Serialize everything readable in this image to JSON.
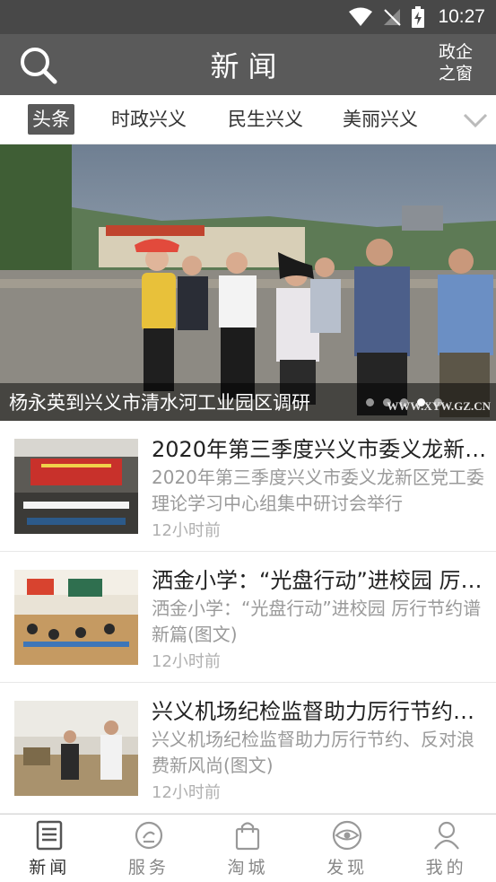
{
  "status_bar": {
    "time": "10:27"
  },
  "header": {
    "title": "新闻",
    "portal_line1": "政企",
    "portal_line2": "之窗"
  },
  "tabs": [
    {
      "label": "头条"
    },
    {
      "label": "时政兴义"
    },
    {
      "label": "民生兴义"
    },
    {
      "label": "美丽兴义"
    }
  ],
  "banner": {
    "caption": "杨永英到兴义市清水河工业园区调研",
    "watermark": "WWW.XYW.GZ.CN",
    "active_slide": 4,
    "slide_count": 5
  },
  "news": [
    {
      "headline": "2020年第三季度兴义市委义龙新区党工委理论学习中心组集中研讨会举行",
      "summary": "2020年第三季度兴义市委义龙新区党工委理论学习中心组集中研讨会举行",
      "time": "12小时前"
    },
    {
      "headline": "洒金小学：“光盘行动”进校园 厉行节约谱新篇(图文)",
      "summary": "洒金小学：“光盘行动”进校园 厉行节约谱新篇(图文)",
      "time": "12小时前"
    },
    {
      "headline": "兴义机场纪检监督助力厉行节约、反对浪费新风尚(图文)",
      "summary": "兴义机场纪检监督助力厉行节约、反对浪费新风尚(图文)",
      "time": "12小时前"
    }
  ],
  "bottom_nav": [
    {
      "label": "新闻",
      "icon": "newspaper-icon"
    },
    {
      "label": "服务",
      "icon": "service-icon"
    },
    {
      "label": "淘城",
      "icon": "shopping-bag-icon"
    },
    {
      "label": "发现",
      "icon": "eye-icon"
    },
    {
      "label": "我的",
      "icon": "user-icon"
    }
  ],
  "colors": {
    "status_bar": "#484848",
    "header": "#5a5a5a",
    "active_tab": "#595959",
    "muted_text": "#9a9a9a"
  }
}
